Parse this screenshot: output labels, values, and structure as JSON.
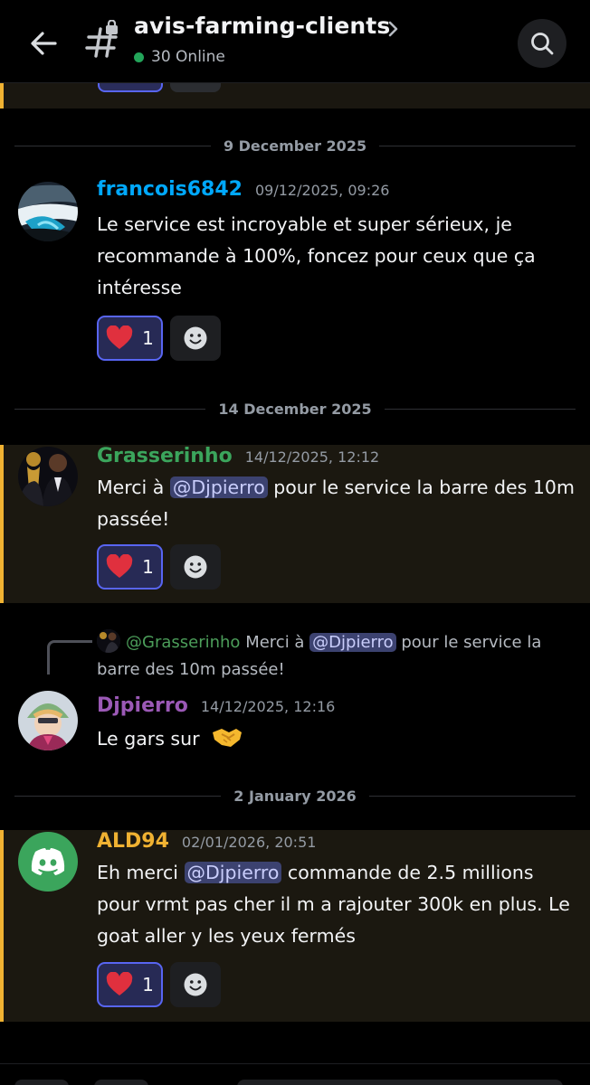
{
  "header": {
    "channel": "avis-farming-clients",
    "online": "30 Online"
  },
  "dividers": [
    "9 December 2025",
    "14 December 2025",
    "2 January 2026"
  ],
  "messages": [
    {
      "author": "francois6842",
      "author_color": "#00a8fc",
      "timestamp": "09/12/2025, 09:26",
      "text": "Le service est incroyable et super sérieux, je recommande à 100%, foncez pour ceux que ça intéresse",
      "reaction": {
        "emoji": "heart",
        "count": "1"
      }
    },
    {
      "author": "Grasserinho",
      "author_color": "#3ba55c",
      "timestamp": "14/12/2025, 12:12",
      "text_before": "Merci à ",
      "mention": "@Djpierro",
      "text_after": " pour le service la barre des 10m passée!",
      "reaction": {
        "emoji": "heart",
        "count": "1"
      }
    },
    {
      "reply_to": "@Grasserinho",
      "reply_before": "Merci à ",
      "reply_mention": "@Djpierro",
      "reply_after": " pour le service la barre des 10m passée!",
      "author": "Djpierro",
      "author_color": "#9b59b6",
      "timestamp": "14/12/2025, 12:16",
      "text": "Le gars sur",
      "emoji": "handshake"
    },
    {
      "author": "ALD94",
      "author_color": "#f0b232",
      "timestamp": "02/01/2026, 20:51",
      "text_before": "Eh merci ",
      "mention": "@Djpierro",
      "text_after": " commande de 2.5 millions pour vrmt pas cher il m a rajouter 300k en plus. Le goat aller y les yeux fermés",
      "reaction": {
        "emoji": "heart",
        "count": "1"
      }
    }
  ],
  "colors": {
    "background": "#000000",
    "highlight": "#1b1810",
    "highlight_bar": "#f0b232",
    "mention_bg": "#3c4270",
    "reaction_border": "#5865f2",
    "online_dot": "#23a55a",
    "discord_green": "#3ba55c"
  }
}
